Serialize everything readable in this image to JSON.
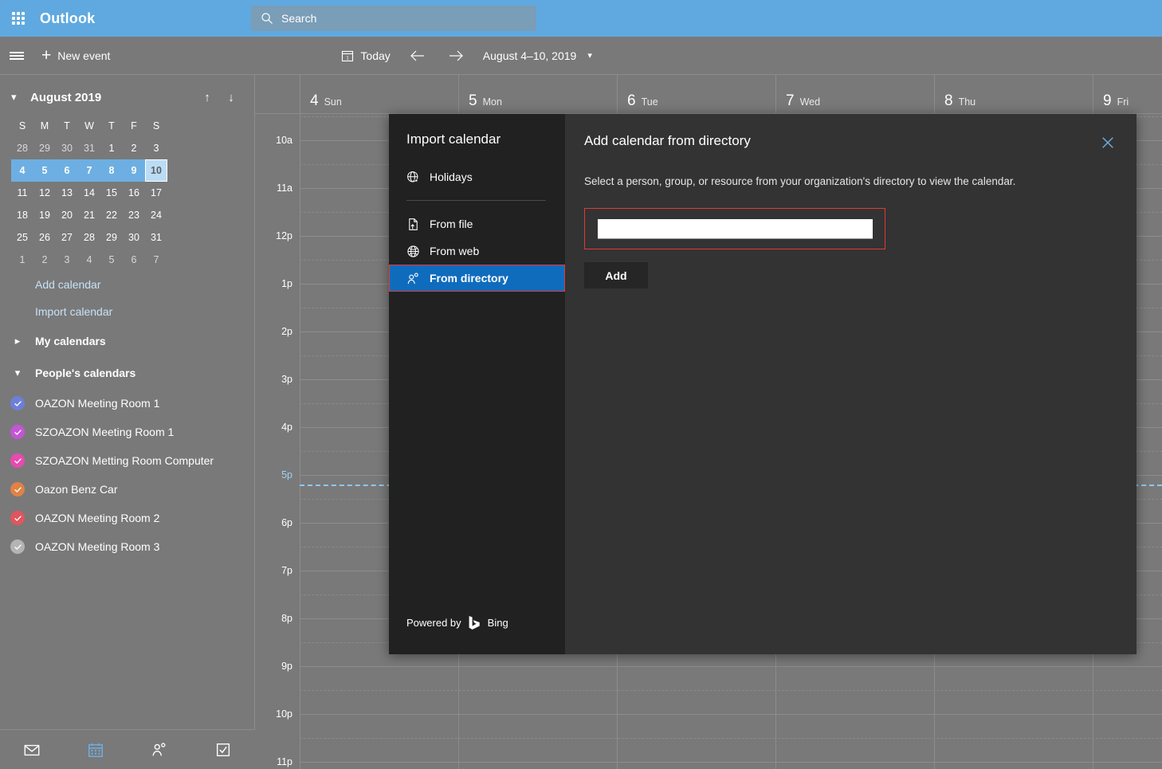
{
  "topbar": {
    "waffle_icon": "app-launcher-icon",
    "brand": "Outlook",
    "search": {
      "icon": "search-icon",
      "placeholder": "Search",
      "value": "Search"
    }
  },
  "commandbar": {
    "menu_icon": "hamburger-icon",
    "new_event": "New event",
    "today_icon": "calendar-today-icon",
    "today": "Today",
    "prev_icon": "arrow-left-icon",
    "next_icon": "arrow-right-icon",
    "date_range": "August 4–10, 2019",
    "date_chevron": "chevron-down-icon"
  },
  "sidebar": {
    "mini_calendar": {
      "collapse_icon": "chevron-down-icon",
      "title": "August 2019",
      "prev_icon": "arrow-up-icon",
      "next_icon": "arrow-down-icon",
      "dow": [
        "S",
        "M",
        "T",
        "W",
        "T",
        "F",
        "S"
      ],
      "weeks": [
        [
          {
            "d": "28",
            "state": "out"
          },
          {
            "d": "29",
            "state": "out"
          },
          {
            "d": "30",
            "state": "out"
          },
          {
            "d": "31",
            "state": "out"
          },
          {
            "d": "1",
            "state": "in"
          },
          {
            "d": "2",
            "state": "in"
          },
          {
            "d": "3",
            "state": "in"
          }
        ],
        [
          {
            "d": "4",
            "state": "week"
          },
          {
            "d": "5",
            "state": "week"
          },
          {
            "d": "6",
            "state": "week"
          },
          {
            "d": "7",
            "state": "week"
          },
          {
            "d": "8",
            "state": "week"
          },
          {
            "d": "9",
            "state": "week"
          },
          {
            "d": "10",
            "state": "today"
          }
        ],
        [
          {
            "d": "11",
            "state": "in"
          },
          {
            "d": "12",
            "state": "in"
          },
          {
            "d": "13",
            "state": "in"
          },
          {
            "d": "14",
            "state": "in"
          },
          {
            "d": "15",
            "state": "in"
          },
          {
            "d": "16",
            "state": "in"
          },
          {
            "d": "17",
            "state": "in"
          }
        ],
        [
          {
            "d": "18",
            "state": "in"
          },
          {
            "d": "19",
            "state": "in"
          },
          {
            "d": "20",
            "state": "in"
          },
          {
            "d": "21",
            "state": "in"
          },
          {
            "d": "22",
            "state": "in"
          },
          {
            "d": "23",
            "state": "in"
          },
          {
            "d": "24",
            "state": "in"
          }
        ],
        [
          {
            "d": "25",
            "state": "in"
          },
          {
            "d": "26",
            "state": "in"
          },
          {
            "d": "27",
            "state": "in"
          },
          {
            "d": "28",
            "state": "in"
          },
          {
            "d": "29",
            "state": "in"
          },
          {
            "d": "30",
            "state": "in"
          },
          {
            "d": "31",
            "state": "in"
          }
        ],
        [
          {
            "d": "1",
            "state": "out"
          },
          {
            "d": "2",
            "state": "out"
          },
          {
            "d": "3",
            "state": "out"
          },
          {
            "d": "4",
            "state": "out"
          },
          {
            "d": "5",
            "state": "out"
          },
          {
            "d": "6",
            "state": "out"
          },
          {
            "d": "7",
            "state": "out"
          }
        ]
      ]
    },
    "add_calendar": "Add calendar",
    "import_calendar": "Import calendar",
    "my_calendars": {
      "label": "My calendars",
      "chevron": "chevron-right-icon",
      "expanded": false
    },
    "peoples_calendars": {
      "label": "People's calendars",
      "chevron": "chevron-down-icon",
      "expanded": true
    },
    "calendars": [
      {
        "label": "OAZON Meeting Room 1",
        "color": "#6E7FD8",
        "checked": true
      },
      {
        "label": "SZOAZON Meeting Room 1",
        "color": "#C455D6",
        "checked": true
      },
      {
        "label": "SZOAZON Metting Room Computer",
        "color": "#E64BB0",
        "checked": true
      },
      {
        "label": "Oazon Benz Car",
        "color": "#E08245",
        "checked": true
      },
      {
        "label": "OAZON Meeting Room 2",
        "color": "#E2555E",
        "checked": true
      },
      {
        "label": "OAZON Meeting Room 3",
        "color": "#B4B4B4",
        "checked": true
      }
    ],
    "app_nav": [
      {
        "icon": "mail-icon",
        "active": false
      },
      {
        "icon": "calendar-icon",
        "active": true
      },
      {
        "icon": "people-icon",
        "active": false
      },
      {
        "icon": "tasks-icon",
        "active": false
      }
    ]
  },
  "calendar": {
    "days": [
      {
        "num": "4",
        "dow": "Sun"
      },
      {
        "num": "5",
        "dow": "Mon"
      },
      {
        "num": "6",
        "dow": "Tue"
      },
      {
        "num": "7",
        "dow": "Wed"
      },
      {
        "num": "8",
        "dow": "Thu"
      },
      {
        "num": "9",
        "dow": "Fri"
      }
    ],
    "hours": [
      "10a",
      "11a",
      "12p",
      "1p",
      "2p",
      "3p",
      "4p",
      "5p",
      "6p",
      "7p",
      "8p",
      "9p",
      "10p",
      "11p"
    ],
    "current_time_hour": "5p",
    "current_time_color": "#8FC8EE"
  },
  "dialog": {
    "left": {
      "title": "Import calendar",
      "items": [
        {
          "label": "Holidays",
          "icon": "globe-star-icon",
          "selected": false
        },
        {
          "label": "From file",
          "icon": "file-upload-icon",
          "selected": false
        },
        {
          "label": "From web",
          "icon": "globe-icon",
          "selected": false
        },
        {
          "label": "From directory",
          "icon": "person-directory-icon",
          "selected": true
        }
      ],
      "footer_text": "Powered by",
      "footer_brand": "Bing",
      "footer_icon": "bing-logo-icon"
    },
    "right": {
      "title": "Add calendar from directory",
      "close_icon": "close-icon",
      "description": "Select a person, group, or resource from your organization's directory to view the calendar.",
      "input": {
        "name": "directory-search-input",
        "value": "",
        "placeholder": ""
      },
      "add_button": "Add"
    },
    "highlight_color": "#E03A36",
    "accent_color": "#0F6CBD"
  }
}
